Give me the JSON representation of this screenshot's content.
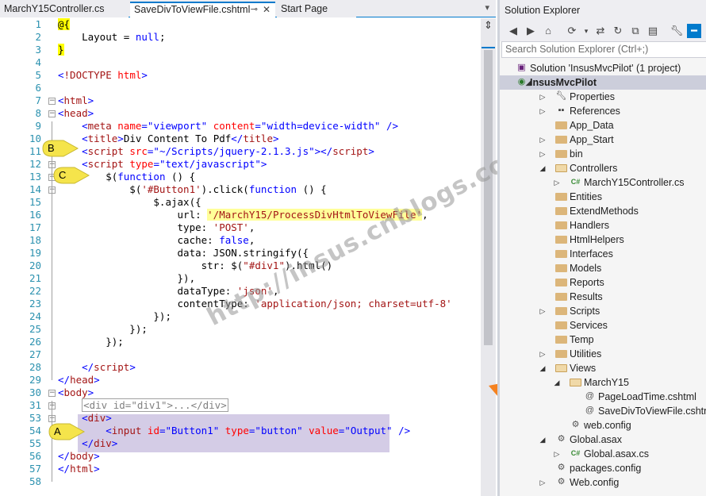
{
  "tabs": [
    {
      "label": "MarchY15Controller.cs",
      "active": false
    },
    {
      "label": "SaveDivToViewFile.cshtml",
      "active": true
    },
    {
      "label": "Start Page",
      "active": false
    }
  ],
  "code_lines": [
    {
      "n": "1",
      "html": "<span class='razor'>@{</span>"
    },
    {
      "n": "2",
      "html": "    Layout = <span class='k-kw'>null</span>;"
    },
    {
      "n": "3",
      "html": "<span class='razor'>}</span>"
    },
    {
      "n": "4",
      "html": ""
    },
    {
      "n": "5",
      "html": "<span class='k-val'>&lt;</span><span class='k-tag'>!DOCTYPE</span> <span class='k-att'>html</span><span class='k-val'>&gt;</span>"
    },
    {
      "n": "6",
      "html": ""
    },
    {
      "n": "7",
      "html": "<span class='k-val'>&lt;</span><span class='k-tag'>html</span><span class='k-val'>&gt;</span>"
    },
    {
      "n": "8",
      "html": "<span class='k-val'>&lt;</span><span class='k-tag'>head</span><span class='k-val'>&gt;</span>"
    },
    {
      "n": "9",
      "html": "    <span class='k-val'>&lt;</span><span class='k-tag'>meta</span> <span class='k-att'>name</span><span class='k-val'>=\"viewport\"</span> <span class='k-att'>content</span><span class='k-val'>=\"width=device-width\"</span> <span class='k-val'>/&gt;</span>"
    },
    {
      "n": "10",
      "html": "    <span class='k-val'>&lt;</span><span class='k-tag'>title</span><span class='k-val'>&gt;</span>Div Content To Pdf<span class='k-val'>&lt;/</span><span class='k-tag'>title</span><span class='k-val'>&gt;</span>"
    },
    {
      "n": "11",
      "html": "    <span class='k-val'>&lt;</span><span class='k-tag'>script</span> <span class='k-att'>src</span><span class='k-val'>=\"~/Scripts/jquery-2.1.3.js\"</span><span class='k-val'>&gt;&lt;/</span><span class='k-tag'>script</span><span class='k-val'>&gt;</span>"
    },
    {
      "n": "12",
      "html": "    <span class='k-val'>&lt;</span><span class='k-tag'>script</span> <span class='k-att'>type</span><span class='k-val'>=\"text/javascript\"</span><span class='k-val'>&gt;</span>"
    },
    {
      "n": "13",
      "html": "        $(<span class='k-kw'>function</span> () {"
    },
    {
      "n": "14",
      "html": "            $(<span class='k-str'>'#Button1'</span>).click(<span class='k-kw'>function</span> () {"
    },
    {
      "n": "15",
      "html": "                $.ajax({"
    },
    {
      "n": "16",
      "html": "                    url: <span class='k-str hl-url'>'/MarchY15/ProcessDivHtmlToViewFile'</span>,"
    },
    {
      "n": "17",
      "html": "                    type: <span class='k-str'>'POST'</span>,"
    },
    {
      "n": "18",
      "html": "                    cache: <span class='k-kw'>false</span>,"
    },
    {
      "n": "19",
      "html": "                    data: JSON.stringify({"
    },
    {
      "n": "20",
      "html": "                        str: $(<span class='k-str'>\"#div1\"</span>).html()"
    },
    {
      "n": "21",
      "html": "                    }),"
    },
    {
      "n": "22",
      "html": "                    dataType: <span class='k-str'>'json'</span>,"
    },
    {
      "n": "23",
      "html": "                    contentType: <span class='k-str'>'application/json; charset=utf-8'</span>"
    },
    {
      "n": "24",
      "html": "                });"
    },
    {
      "n": "25",
      "html": "            });"
    },
    {
      "n": "26",
      "html": "        });"
    },
    {
      "n": "27",
      "html": ""
    },
    {
      "n": "28",
      "html": "    <span class='k-val'>&lt;/</span><span class='k-tag'>script</span><span class='k-val'>&gt;</span>"
    },
    {
      "n": "29",
      "html": "<span class='k-val'>&lt;/</span><span class='k-tag'>head</span><span class='k-val'>&gt;</span>"
    },
    {
      "n": "30",
      "html": "<span class='k-val'>&lt;</span><span class='k-tag'>body</span><span class='k-val'>&gt;</span>"
    },
    {
      "n": "31",
      "html": "    <span class='collapsed-box'>&lt;div id=\"div1\"&gt;...&lt;/div&gt;</span>"
    },
    {
      "n": "53",
      "html": "    <span class='k-val'>&lt;</span><span class='k-tag'>div</span><span class='k-val'>&gt;</span>"
    },
    {
      "n": "54",
      "html": "        <span class='k-val'>&lt;</span><span class='k-tag'>input</span> <span class='k-att'>id</span><span class='k-val'>=\"Button1\"</span> <span class='k-att'>type</span><span class='k-val'>=\"button\"</span> <span class='k-att'>value</span><span class='k-val'>=\"Output\"</span> <span class='k-val'>/&gt;</span>"
    },
    {
      "n": "55",
      "html": "    <span class='k-val'>&lt;/</span><span class='k-tag'>div</span><span class='k-val'>&gt;</span>"
    },
    {
      "n": "56",
      "html": "<span class='k-val'>&lt;/</span><span class='k-tag'>body</span><span class='k-val'>&gt;</span>"
    },
    {
      "n": "57",
      "html": "<span class='k-val'>&lt;/</span><span class='k-tag'>html</span><span class='k-val'>&gt;</span>"
    },
    {
      "n": "58",
      "html": ""
    }
  ],
  "callouts": {
    "a": "A",
    "b": "B",
    "c": "C"
  },
  "watermark": "http://insus.cnblogs.com",
  "solution_explorer": {
    "title": "Solution Explorer",
    "search_placeholder": "Search Solution Explorer (Ctrl+;)",
    "items": [
      {
        "label": "Solution 'InsusMvcPilot' (1 project)",
        "depth": 0,
        "arrow": "",
        "icon": "solution-icon",
        "bold": false
      },
      {
        "label": "InsusMvcPilot",
        "depth": 0,
        "arrow": "open",
        "icon": "web-project-icon",
        "bold": true
      },
      {
        "label": "Properties",
        "depth": 1,
        "arrow": "closed",
        "icon": "wrench-icon",
        "bold": false
      },
      {
        "label": "References",
        "depth": 1,
        "arrow": "closed",
        "icon": "references-icon",
        "bold": false
      },
      {
        "label": "App_Data",
        "depth": 1,
        "arrow": "",
        "icon": "folder-icon",
        "bold": false
      },
      {
        "label": "App_Start",
        "depth": 1,
        "arrow": "closed",
        "icon": "folder-icon",
        "bold": false
      },
      {
        "label": "bin",
        "depth": 1,
        "arrow": "closed",
        "icon": "folder-icon",
        "bold": false
      },
      {
        "label": "Controllers",
        "depth": 1,
        "arrow": "open",
        "icon": "folder-open-icon",
        "bold": false
      },
      {
        "label": "MarchY15Controller.cs",
        "depth": 2,
        "arrow": "closed",
        "icon": "csharp-file-icon",
        "bold": false
      },
      {
        "label": "Entities",
        "depth": 1,
        "arrow": "",
        "icon": "folder-icon",
        "bold": false
      },
      {
        "label": "ExtendMethods",
        "depth": 1,
        "arrow": "",
        "icon": "folder-icon",
        "bold": false
      },
      {
        "label": "Handlers",
        "depth": 1,
        "arrow": "",
        "icon": "folder-icon",
        "bold": false
      },
      {
        "label": "HtmlHelpers",
        "depth": 1,
        "arrow": "",
        "icon": "folder-icon",
        "bold": false
      },
      {
        "label": "Interfaces",
        "depth": 1,
        "arrow": "",
        "icon": "folder-icon",
        "bold": false
      },
      {
        "label": "Models",
        "depth": 1,
        "arrow": "",
        "icon": "folder-icon",
        "bold": false
      },
      {
        "label": "Reports",
        "depth": 1,
        "arrow": "",
        "icon": "folder-icon",
        "bold": false
      },
      {
        "label": "Results",
        "depth": 1,
        "arrow": "",
        "icon": "folder-icon",
        "bold": false
      },
      {
        "label": "Scripts",
        "depth": 1,
        "arrow": "closed",
        "icon": "folder-icon",
        "bold": false
      },
      {
        "label": "Services",
        "depth": 1,
        "arrow": "",
        "icon": "folder-icon",
        "bold": false
      },
      {
        "label": "Temp",
        "depth": 1,
        "arrow": "",
        "icon": "folder-icon",
        "bold": false
      },
      {
        "label": "Utilities",
        "depth": 1,
        "arrow": "closed",
        "icon": "folder-icon",
        "bold": false
      },
      {
        "label": "Views",
        "depth": 1,
        "arrow": "open",
        "icon": "folder-open-icon",
        "bold": false
      },
      {
        "label": "MarchY15",
        "depth": 2,
        "arrow": "open",
        "icon": "folder-open-icon",
        "bold": false
      },
      {
        "label": "PageLoadTime.cshtml",
        "depth": 3,
        "arrow": "",
        "icon": "razor-file-icon",
        "bold": false
      },
      {
        "label": "SaveDivToViewFile.cshtml",
        "depth": 3,
        "arrow": "",
        "icon": "razor-file-icon",
        "bold": false
      },
      {
        "label": "web.config",
        "depth": 2,
        "arrow": "",
        "icon": "config-file-icon",
        "bold": false
      },
      {
        "label": "Global.asax",
        "depth": 1,
        "arrow": "open",
        "icon": "global-icon",
        "bold": false
      },
      {
        "label": "Global.asax.cs",
        "depth": 2,
        "arrow": "closed",
        "icon": "csharp-file-icon",
        "bold": false
      },
      {
        "label": "packages.config",
        "depth": 1,
        "arrow": "",
        "icon": "config-file-icon",
        "bold": false
      },
      {
        "label": "Web.config",
        "depth": 1,
        "arrow": "closed",
        "icon": "config-file-icon",
        "bold": false
      }
    ]
  },
  "colors": {
    "accent": "#007acc",
    "callout": "#f5e44b",
    "arrow": "#f58220",
    "selection": "#d4cce6"
  }
}
